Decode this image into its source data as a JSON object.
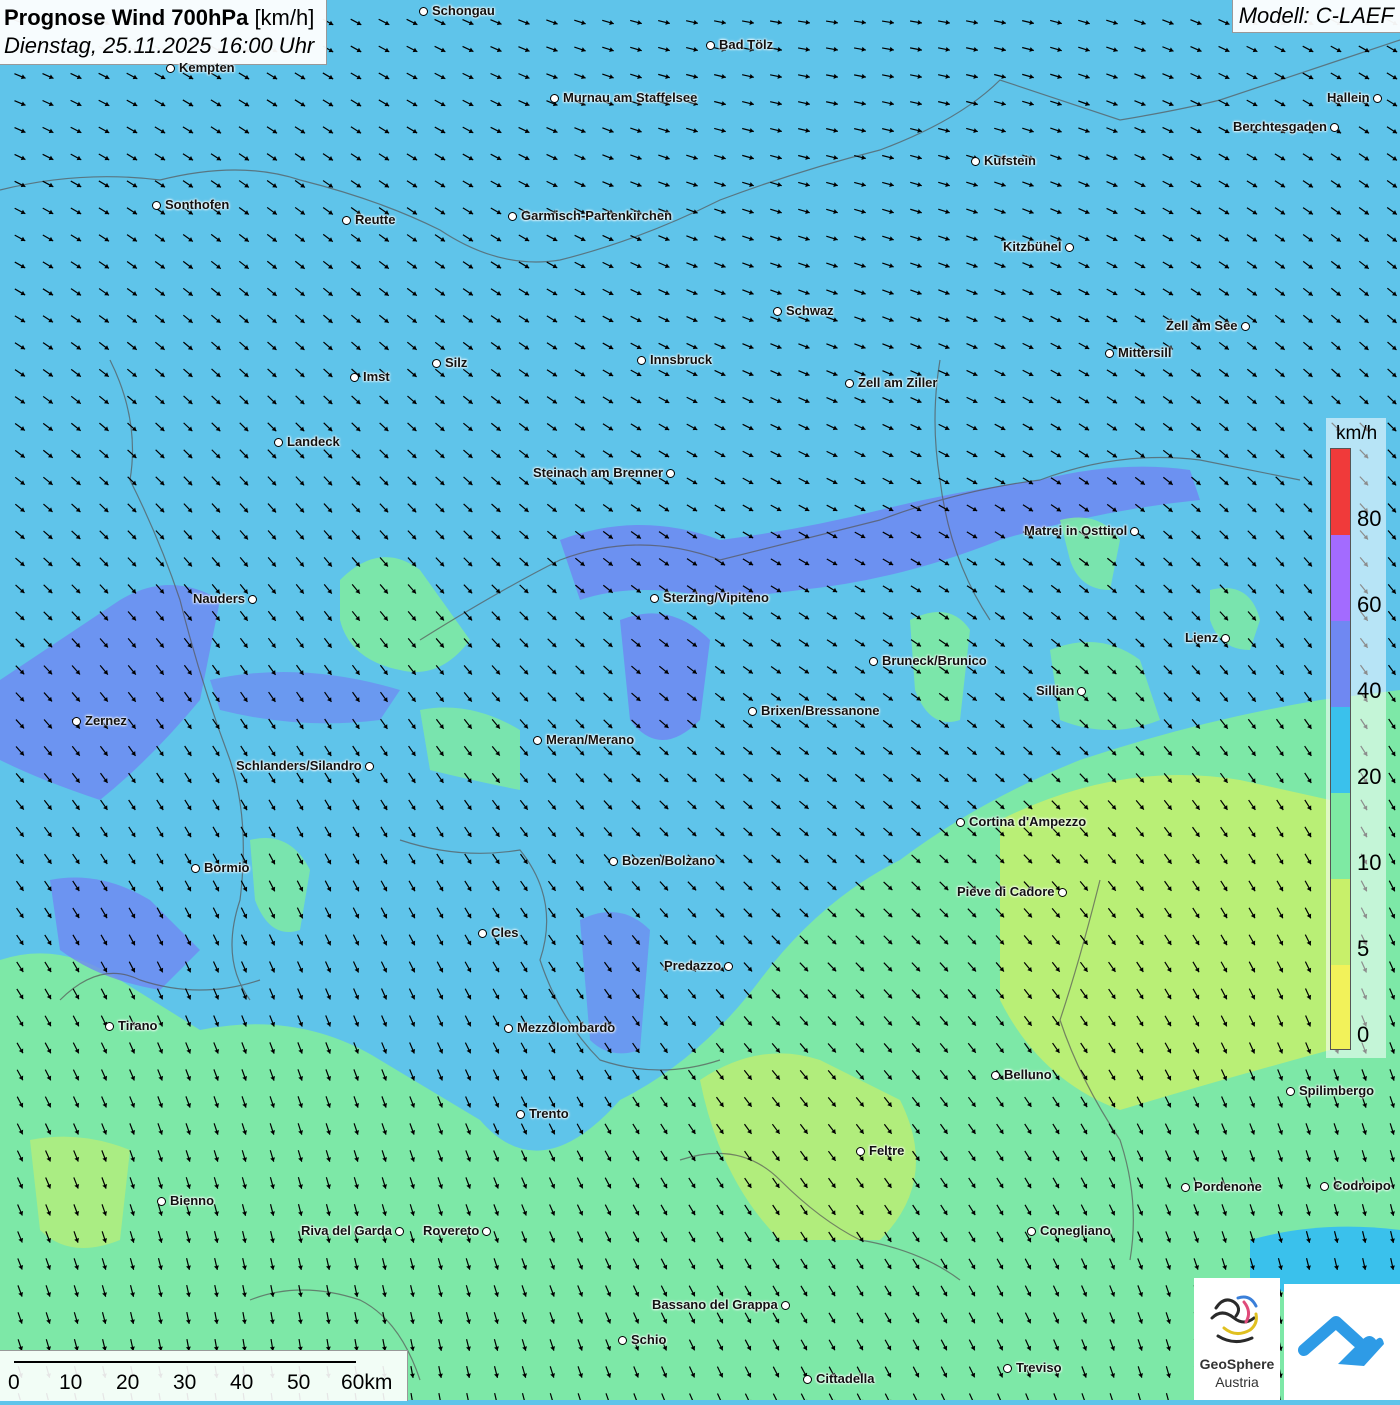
{
  "title": {
    "main": "Prognose Wind 700hPa",
    "unit": "[km/h]",
    "date": "Dienstag, 25.11.2025 16:00 Uhr"
  },
  "model": "Modell: C-LAEF",
  "legend": {
    "unit": "km/h",
    "labels": [
      "80",
      "60",
      "40",
      "20",
      "10",
      "5",
      "0"
    ],
    "colors": {
      "above80": "#f03a3a",
      "60_80": "#a36bff",
      "40_60": "#6f88f2",
      "20_40": "#3ac1ec",
      "10_20": "#7eeaa3",
      "5_10": "#c8f06a",
      "0_5": "#f2f25a"
    }
  },
  "scale": {
    "labels": [
      "0",
      "10",
      "20",
      "30",
      "40",
      "50",
      "60km"
    ]
  },
  "cities": [
    "Schongau",
    "Bad Tölz",
    "Kempten",
    "Murnau am Staffelsee",
    "Hallein",
    "Berchtesgaden",
    "Kufstein",
    "Sonthofen",
    "Reutte",
    "Garmisch-Partenkirchen",
    "Kitzbühel",
    "Schwaz",
    "Zell am See",
    "Mittersill",
    "Silz",
    "Imst",
    "Innsbruck",
    "Zell am Ziller",
    "Landeck",
    "Steinach am Brenner",
    "Matrei in Osttirol",
    "Nauders",
    "Sterzing/Vipiteno",
    "Lienz",
    "Bruneck/Brunico",
    "Sillian",
    "Zernez",
    "Brixen/Bressanone",
    "Meran/Merano",
    "Schlanders/Silandro",
    "Cortina d'Ampezzo",
    "Bozen/Bolzano",
    "Pieve di Cadore",
    "Bormio",
    "Cles",
    "Predazzo",
    "Tirano",
    "Mezzolombardo",
    "Belluno",
    "Spilimbergo",
    "Trento",
    "Feltre",
    "Bienno",
    "Pordenone",
    "Codroipo",
    "Riva del Garda",
    "Rovereto",
    "Conegliano",
    "Bassano del Grappa",
    "Schio",
    "Treviso",
    "Cittadella"
  ],
  "logos": {
    "geosphere_line1": "GeoSphere",
    "geosphere_line2": "Austria"
  },
  "colors": {
    "wind_arrow": "#000000",
    "border_line": "#555555"
  }
}
